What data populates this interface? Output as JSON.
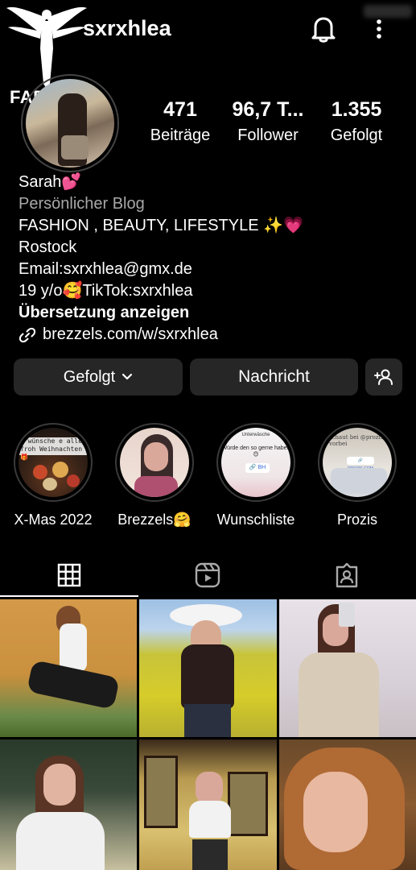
{
  "header": {
    "username": "sxrxhlea",
    "watermark_text": "FAPEZA",
    "icons": [
      "bell-icon",
      "more-vertical-icon"
    ]
  },
  "stats": {
    "posts": {
      "value": "471",
      "label": "Beiträge"
    },
    "followers": {
      "value": "96,7 T...",
      "label": "Follower"
    },
    "following": {
      "value": "1.355",
      "label": "Gefolgt"
    }
  },
  "bio": {
    "name": "Sarah💕",
    "category": "Persönlicher Blog",
    "lines": [
      "FASHION , BEAUTY, LIFESTYLE ✨💗",
      "Rostock",
      "Email:sxrxhlea@gmx.de",
      "19 y/o🥰TikTok:sxrxhlea"
    ],
    "translate": "Übersetzung anzeigen",
    "link": "brezzels.com/w/sxrxhlea"
  },
  "actions": {
    "following_label": "Gefolgt",
    "message_label": "Nachricht"
  },
  "highlights": [
    {
      "label": "X-Mas 2022",
      "overlay_text": "n wünsche e allen froh Weihnachten 🎁"
    },
    {
      "label": "Brezzels🤗"
    },
    {
      "label": "Wunschliste",
      "overlay_text": "Unterwäsche",
      "overlay_text2": "Würde den so gerne haben 😊",
      "overlay_text3": "🔗 BH"
    },
    {
      "label": "Prozis",
      "overlay_text": "schaut bei @prozis vorbei",
      "overlay_text2": "🔗 PROZIS.COM"
    }
  ],
  "tabs": [
    "grid-icon",
    "reels-icon",
    "tagged-icon"
  ],
  "colors": {
    "background": "#000000",
    "button_bg": "#262626",
    "secondary_text": "#a8a8a8"
  }
}
